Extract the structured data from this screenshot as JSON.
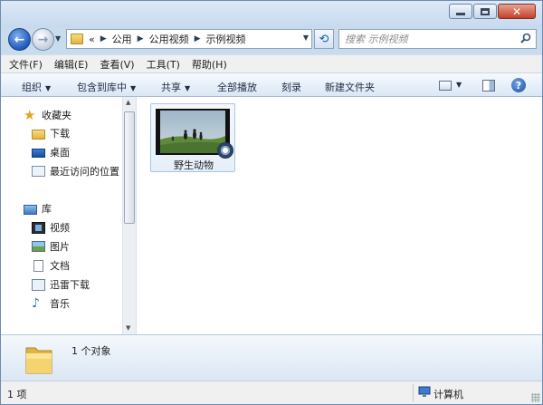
{
  "window": {
    "buttons": {
      "minimize": "minimize",
      "maximize": "maximize",
      "close": "close"
    }
  },
  "navigation": {
    "back": "back",
    "forward": "forward",
    "address": {
      "overflow": "«",
      "crumbs": [
        "公用",
        "公用视频",
        "示例视频"
      ]
    },
    "search_placeholder": "搜索 示例视频"
  },
  "menu": [
    "文件(F)",
    "编辑(E)",
    "查看(V)",
    "工具(T)",
    "帮助(H)"
  ],
  "toolbar": {
    "organize": "组织",
    "include_in_library": "包含到库中",
    "share": "共享",
    "play_all": "全部播放",
    "burn": "刻录",
    "new_folder": "新建文件夹"
  },
  "nav_pane": {
    "favorites": {
      "label": "收藏夹",
      "icon": "star-icon"
    },
    "favorite_items": [
      {
        "label": "下载",
        "icon": "download-folder-icon"
      },
      {
        "label": "桌面",
        "icon": "desktop-icon"
      },
      {
        "label": "最近访问的位置",
        "icon": "recent-places-icon"
      }
    ],
    "libraries": {
      "label": "库",
      "icon": "library-icon"
    },
    "library_items": [
      {
        "label": "视频",
        "icon": "video-library-icon"
      },
      {
        "label": "图片",
        "icon": "picture-library-icon"
      },
      {
        "label": "文档",
        "icon": "document-library-icon"
      },
      {
        "label": "迅雷下载",
        "icon": "xunlei-download-icon"
      },
      {
        "label": "音乐",
        "icon": "music-library-icon"
      }
    ]
  },
  "content": {
    "items": [
      {
        "name": "野生动物",
        "type": "video"
      }
    ]
  },
  "details_pane": {
    "count": "1 个对象"
  },
  "status_bar": {
    "count": "1 项",
    "location": "计算机"
  }
}
